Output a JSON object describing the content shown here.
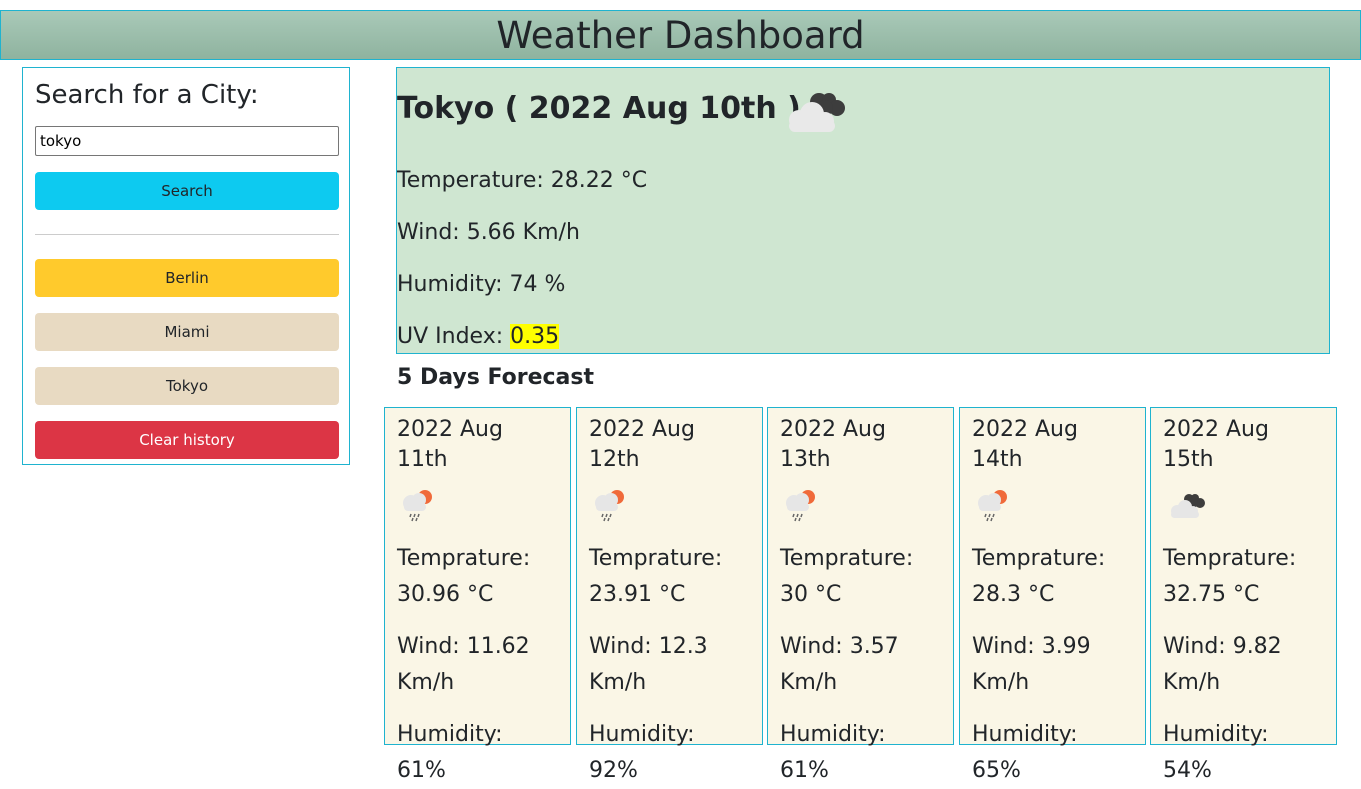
{
  "header": {
    "title": "Weather Dashboard"
  },
  "search": {
    "heading": "Search for a City:",
    "input_value": "tokyo",
    "button_label": "Search"
  },
  "history": {
    "items": [
      {
        "label": "Berlin"
      },
      {
        "label": "Miami"
      },
      {
        "label": "Tokyo"
      }
    ],
    "clear_label": "Clear history"
  },
  "current": {
    "title": "Tokyo ( 2022 Aug 10th )",
    "icon": "broken-clouds-icon",
    "temperature": "Temperature: 28.22 °C",
    "wind": "Wind: 5.66 Km/h",
    "humidity": "Humidity: 74 %",
    "uv_label": "UV Index: ",
    "uv_value": "0.35"
  },
  "forecast": {
    "title": "5 Days Forecast",
    "days": [
      {
        "date": "2022 Aug 11th",
        "icon": "rain-icon",
        "temp": "Temprature: 30.96 °C",
        "wind": "Wind: 11.62 Km/h",
        "humidity": "Humidity: 61%"
      },
      {
        "date": "2022 Aug 12th",
        "icon": "rain-icon",
        "temp": "Temprature: 23.91 °C",
        "wind": "Wind: 12.3 Km/h",
        "humidity": "Humidity: 92%"
      },
      {
        "date": "2022 Aug 13th",
        "icon": "rain-icon",
        "temp": "Temprature: 30 °C",
        "wind": "Wind: 3.57 Km/h",
        "humidity": "Humidity: 61%"
      },
      {
        "date": "2022 Aug 14th",
        "icon": "rain-icon",
        "temp": "Temprature: 28.3 °C",
        "wind": "Wind: 3.99 Km/h",
        "humidity": "Humidity: 65%"
      },
      {
        "date": "2022 Aug 15th",
        "icon": "broken-clouds-icon",
        "temp": "Temprature: 32.75 °C",
        "wind": "Wind: 9.82 Km/h",
        "humidity": "Humidity: 54%"
      }
    ]
  }
}
